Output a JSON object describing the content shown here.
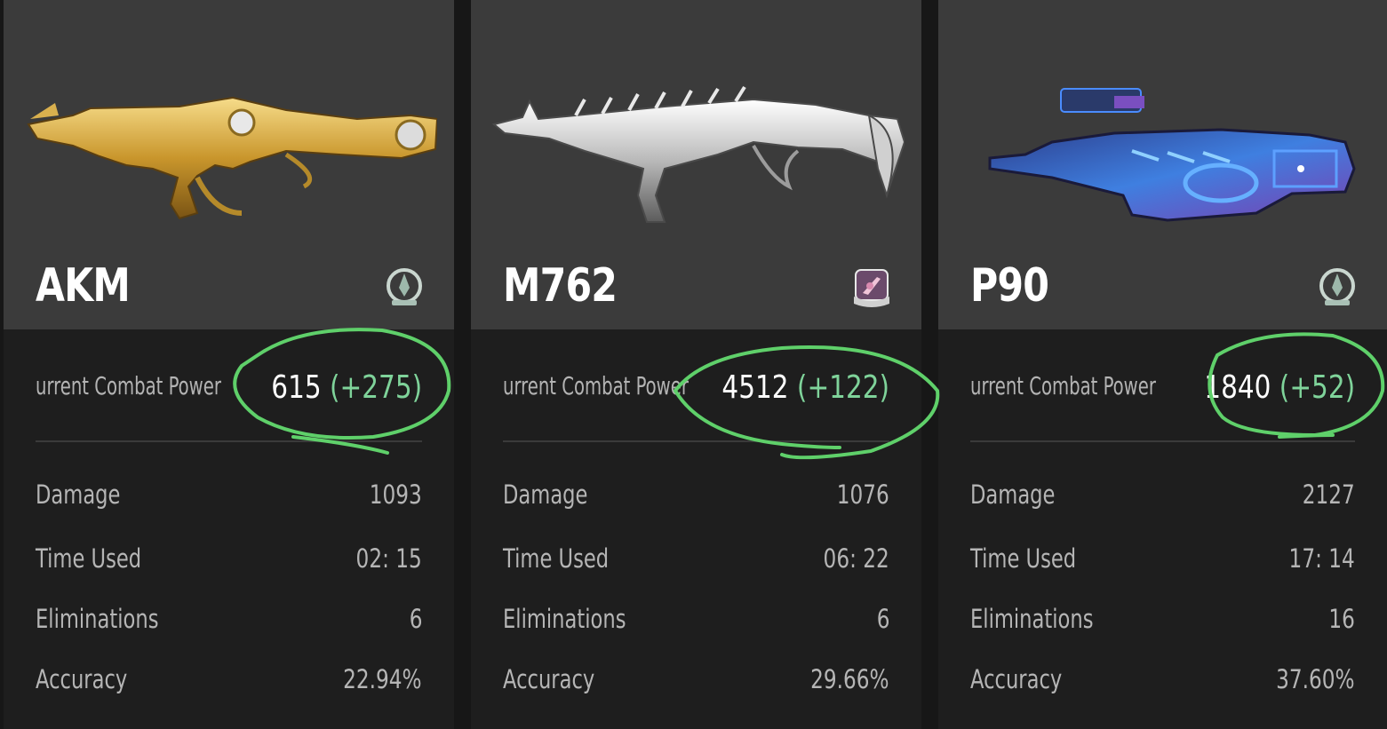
{
  "colors": {
    "highlight_circle": "#5fd06a",
    "delta_text": "#7fd39a",
    "card_top": "#3b3b3b",
    "card_bottom": "#1e1e1e"
  },
  "cards": [
    {
      "weapon": "AKM",
      "weapon_icon": "gold-akm-skin-icon",
      "rank_icon": "rank-emblem-icon",
      "combat_power_label": "urrent Combat Power",
      "combat_power": "615",
      "combat_power_delta": "(+275)",
      "stats": [
        {
          "label": "Damage",
          "value": "1093"
        },
        {
          "label": "Time Used",
          "value": "02: 15"
        },
        {
          "label": "Eliminations",
          "value": "6"
        },
        {
          "label": "Accuracy",
          "value": "22.94%"
        }
      ]
    },
    {
      "weapon": "M762",
      "weapon_icon": "silver-m762-skin-icon",
      "rank_icon": "rank-badge-purple-icon",
      "combat_power_label": "urrent Combat Power",
      "combat_power": "4512",
      "combat_power_delta": "(+122)",
      "stats": [
        {
          "label": "Damage",
          "value": "1076"
        },
        {
          "label": "Time Used",
          "value": "06: 22"
        },
        {
          "label": "Eliminations",
          "value": "6"
        },
        {
          "label": "Accuracy",
          "value": "29.66%"
        }
      ]
    },
    {
      "weapon": "P90",
      "weapon_icon": "neon-p90-skin-icon",
      "rank_icon": "rank-emblem-icon",
      "combat_power_label": "urrent Combat Power",
      "combat_power": "1840",
      "combat_power_delta": "(+52)",
      "stats": [
        {
          "label": "Damage",
          "value": "2127"
        },
        {
          "label": "Time Used",
          "value": "17: 14"
        },
        {
          "label": "Eliminations",
          "value": "16"
        },
        {
          "label": "Accuracy",
          "value": "37.60%"
        }
      ]
    }
  ]
}
